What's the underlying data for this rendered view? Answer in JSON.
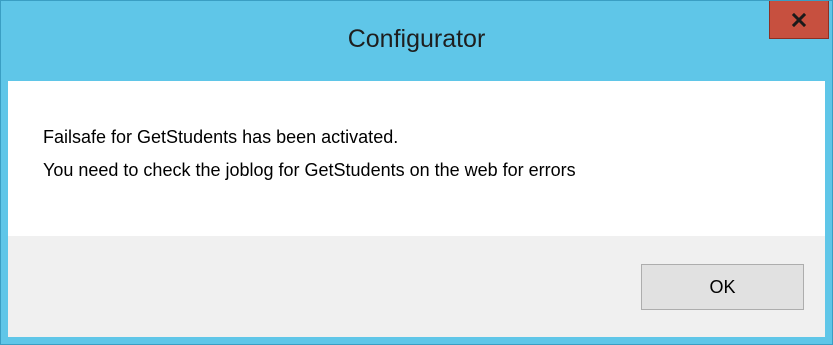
{
  "window": {
    "title": "Configurator",
    "close_icon": "close-icon"
  },
  "message": {
    "line1": "Failsafe for GetStudents has been activated.",
    "line2": "You need to check the joblog for GetStudents on the web for errors"
  },
  "buttons": {
    "ok_label": "OK"
  },
  "colors": {
    "titlebar": "#5fc6e8",
    "close_button": "#c7503f",
    "message_background": "#ffffff",
    "footer_background": "#f0f0f0"
  }
}
